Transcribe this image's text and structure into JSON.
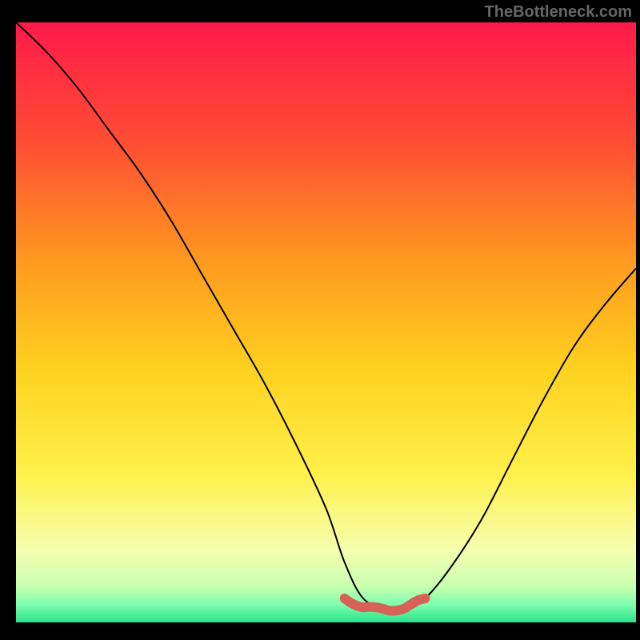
{
  "watermark": "TheBottleneck.com",
  "chart_data": {
    "type": "line",
    "title": "",
    "xlabel": "",
    "ylabel": "",
    "xlim": [
      0,
      100
    ],
    "ylim": [
      0,
      100
    ],
    "grid": false,
    "legend": false,
    "background_gradient": [
      {
        "stop": 0.0,
        "color": "#ff1a4a"
      },
      {
        "stop": 0.2,
        "color": "#ff4d33"
      },
      {
        "stop": 0.4,
        "color": "#ff9a1f"
      },
      {
        "stop": 0.58,
        "color": "#ffd21f"
      },
      {
        "stop": 0.75,
        "color": "#fff04a"
      },
      {
        "stop": 0.88,
        "color": "#f6ffb0"
      },
      {
        "stop": 0.94,
        "color": "#c8ffb0"
      },
      {
        "stop": 0.97,
        "color": "#7dffad"
      },
      {
        "stop": 1.0,
        "color": "#29e28a"
      }
    ],
    "series": [
      {
        "name": "bottleneck-curve",
        "color": "#000000",
        "x": [
          0,
          5,
          10,
          15,
          20,
          25,
          30,
          35,
          40,
          45,
          50,
          53,
          56,
          60,
          63,
          66,
          70,
          75,
          80,
          85,
          90,
          95,
          100
        ],
        "y": [
          100,
          95,
          89,
          82,
          75,
          67,
          58,
          49,
          40,
          30,
          19,
          10,
          4,
          2,
          2,
          4,
          9,
          17,
          27,
          37,
          46,
          53,
          59
        ]
      },
      {
        "name": "trough-marker",
        "color": "#d66257",
        "style": "blob",
        "x": [
          53,
          56,
          60,
          63,
          66
        ],
        "y": [
          4,
          2.5,
          2,
          2.5,
          4
        ]
      }
    ]
  }
}
